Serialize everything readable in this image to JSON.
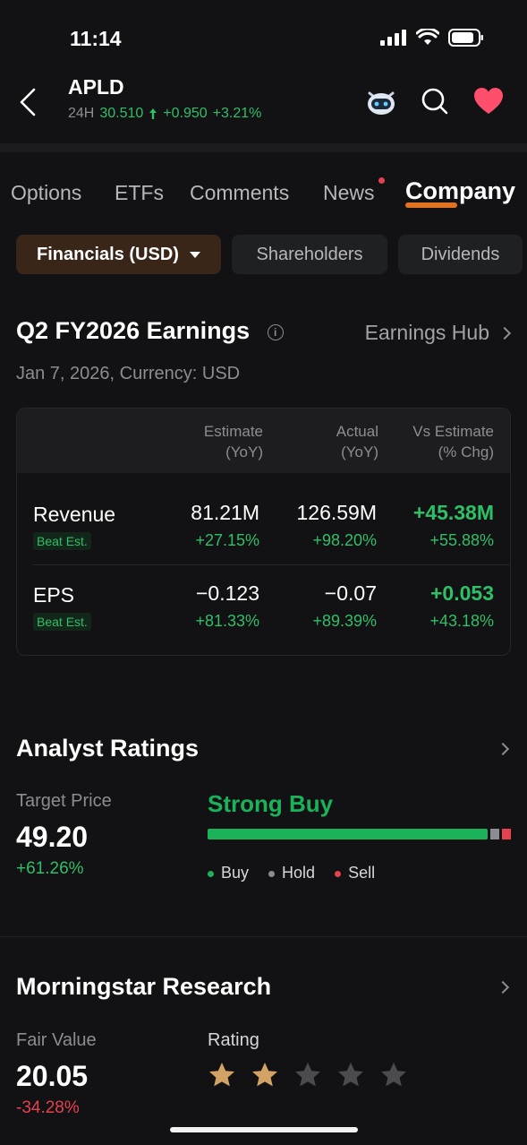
{
  "status": {
    "time": "11:14"
  },
  "header": {
    "ticker": "APLD",
    "period": "24H",
    "price": "30.510",
    "change": "+0.950",
    "change_pct": "+3.21%"
  },
  "tabs": [
    {
      "label": "Options"
    },
    {
      "label": "ETFs"
    },
    {
      "label": "Comments"
    },
    {
      "label": "News"
    },
    {
      "label": "Company"
    }
  ],
  "chips": [
    {
      "label": "Financials (USD)"
    },
    {
      "label": "Shareholders"
    },
    {
      "label": "Dividends"
    }
  ],
  "earnings": {
    "title": "Q2 FY2026 Earnings",
    "hub_link": "Earnings Hub",
    "date_line": "Jan 7, 2026, Currency: USD",
    "columns": {
      "estimate_1": "Estimate",
      "estimate_2": "(YoY)",
      "actual_1": "Actual",
      "actual_2": "(YoY)",
      "vs_1": "Vs Estimate",
      "vs_2": "(% Chg)"
    },
    "rows": [
      {
        "metric": "Revenue",
        "badge": "Beat Est.",
        "estimate": "81.21M",
        "estimate_yoy": "+27.15%",
        "actual": "126.59M",
        "actual_yoy": "+98.20%",
        "vs": "+45.38M",
        "vs_pct": "+55.88%"
      },
      {
        "metric": "EPS",
        "badge": "Beat Est.",
        "estimate": "−0.123",
        "estimate_yoy": "+81.33%",
        "actual": "−0.07",
        "actual_yoy": "+89.39%",
        "vs": "+0.053",
        "vs_pct": "+43.18%"
      }
    ]
  },
  "analyst": {
    "title": "Analyst Ratings",
    "target_label": "Target Price",
    "target_value": "49.20",
    "target_change": "+61.26%",
    "consensus": "Strong Buy",
    "distribution": {
      "buy": 0.94,
      "hold": 0.03,
      "sell": 0.03
    },
    "legend": {
      "buy": "Buy",
      "hold": "Hold",
      "sell": "Sell"
    },
    "colors": {
      "buy": "#1bb35a",
      "hold": "#8c8c92",
      "sell": "#e5414f"
    }
  },
  "morningstar": {
    "title": "Morningstar Research",
    "fair_value_label": "Fair Value",
    "fair_value": "20.05",
    "fair_value_change": "-34.28%",
    "rating_label": "Rating",
    "rating_stars": 2,
    "rating_max": 5
  },
  "colors": {
    "accent": "#e1721f",
    "positive": "#2fbf67",
    "negative": "#e5414f",
    "star_on": "#d2a364",
    "star_off": "#4a4a4f"
  }
}
